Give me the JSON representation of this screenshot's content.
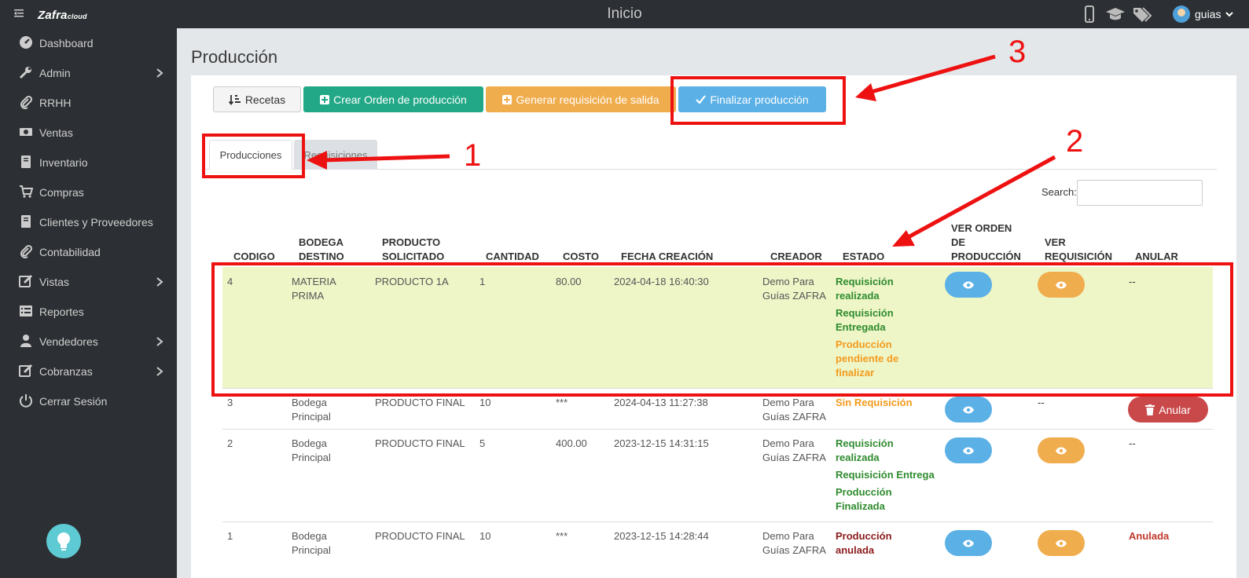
{
  "topbar": {
    "title": "Inicio",
    "logo": "Zafra",
    "logo_suffix": "cloud",
    "user": "guias"
  },
  "sidebar": {
    "items": [
      {
        "label": "Dashboard",
        "icon": "dashboard-icon"
      },
      {
        "label": "Admin",
        "icon": "wrench-icon",
        "chevron": true
      },
      {
        "label": "RRHH",
        "icon": "paperclip-icon"
      },
      {
        "label": "Ventas",
        "icon": "money-icon"
      },
      {
        "label": "Inventario",
        "icon": "book-icon"
      },
      {
        "label": "Compras",
        "icon": "cart-icon"
      },
      {
        "label": "Clientes y Proveedores",
        "icon": "book-icon"
      },
      {
        "label": "Contabilidad",
        "icon": "paperclip-icon"
      },
      {
        "label": "Vistas",
        "icon": "edit-icon",
        "chevron": true
      },
      {
        "label": "Reportes",
        "icon": "list-icon"
      },
      {
        "label": "Vendedores",
        "icon": "user-icon",
        "chevron": true
      },
      {
        "label": "Cobranzas",
        "icon": "edit-icon",
        "chevron": true
      },
      {
        "label": "Cerrar Sesión",
        "icon": "power-icon"
      }
    ]
  },
  "page": {
    "title": "Producción"
  },
  "toolbar": {
    "recetas": "Recetas",
    "crear": "Crear Orden de producción",
    "generar": "Generar requisición de salida",
    "finalizar": "Finalizar producción"
  },
  "tabs": {
    "producciones": "Producciones",
    "requisiciones": "Requisiciones"
  },
  "search": {
    "label": "Search:"
  },
  "table": {
    "headers": {
      "codigo": "CODIGO",
      "bodega1": "BODEGA",
      "bodega2": "DESTINO",
      "producto1": "PRODUCTO",
      "producto2": "SOLICITADO",
      "cantidad": "CANTIDAD",
      "costo": "COSTO",
      "fecha": "FECHA CREACIÓN",
      "creador": "CREADOR",
      "estado": "ESTADO",
      "ver_orden1": "VER ORDEN",
      "ver_orden2": "DE",
      "ver_orden3": "PRODUCCIÓN",
      "ver_req1": "VER",
      "ver_req2": "REQUISICIÓN",
      "anular": "ANULAR"
    },
    "rows": [
      {
        "codigo": "4",
        "bodega1": "MATERIA",
        "bodega2": "PRIMA",
        "producto": "PRODUCTO 1A",
        "cantidad": "1",
        "costo": "80.00",
        "fecha": "2024-04-18 16:40:30",
        "creador1": "Demo Para",
        "creador2": "Guías ZAFRA",
        "estado": [
          "Requisición",
          "realizada",
          "Requisición",
          "Entregada",
          "Producción",
          "pendiente de",
          "finalizar"
        ],
        "anular": "--"
      },
      {
        "codigo": "3",
        "bodega1": "Bodega",
        "bodega2": "Principal",
        "producto": "PRODUCTO FINAL",
        "cantidad": "10",
        "costo": "***",
        "fecha": "2024-04-13 11:27:38",
        "creador1": "Demo Para",
        "creador2": "Guías ZAFRA",
        "estado": [
          "Sin Requisición"
        ],
        "ver_req": "--",
        "anular": "Anular"
      },
      {
        "codigo": "2",
        "bodega1": "Bodega",
        "bodega2": "Principal",
        "producto": "PRODUCTO FINAL",
        "cantidad": "5",
        "costo": "400.00",
        "fecha": "2023-12-15 14:31:15",
        "creador1": "Demo Para",
        "creador2": "Guías ZAFRA",
        "estado": [
          "Requisición",
          "realizada",
          "Requisición Entrega",
          "Producción",
          "Finalizada"
        ],
        "anular": "--"
      },
      {
        "codigo": "1",
        "bodega1": "Bodega",
        "bodega2": "Principal",
        "producto": "PRODUCTO FINAL",
        "cantidad": "10",
        "costo": "***",
        "fecha": "2023-12-15 14:28:44",
        "creador1": "Demo Para",
        "creador2": "Guías ZAFRA",
        "estado": [
          "Producción",
          "anulada"
        ],
        "anular": "Anulada"
      }
    ]
  },
  "annotations": {
    "n1": "1",
    "n2": "2",
    "n3": "3",
    "color": "#ee1111"
  }
}
